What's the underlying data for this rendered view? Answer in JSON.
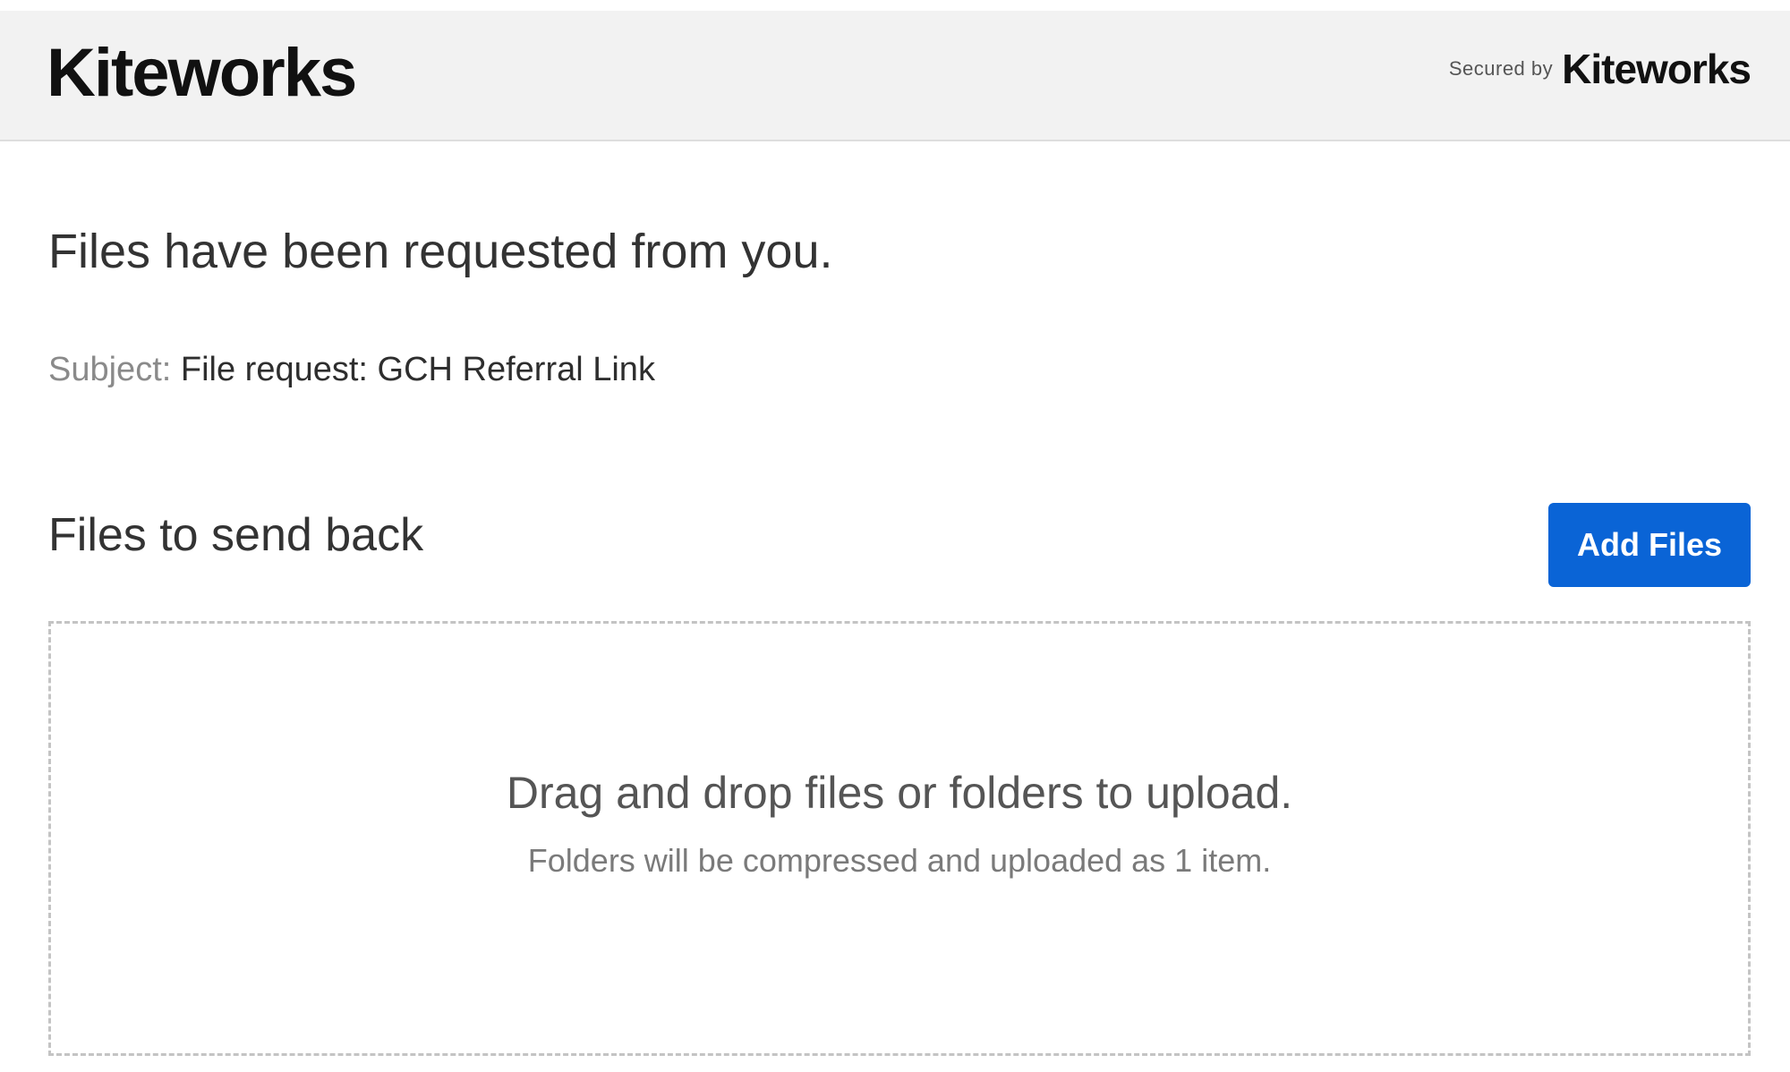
{
  "header": {
    "brand": "Kiteworks",
    "secured_by_text": "Secured by",
    "secured_by_brand": "Kiteworks"
  },
  "request": {
    "title": "Files have been requested from you.",
    "subject_label": "Subject:",
    "subject_value": "File request: GCH Referral Link"
  },
  "files_section": {
    "title": "Files to send back",
    "add_files_label": "Add Files",
    "dropzone_primary": "Drag and drop files or folders to upload.",
    "dropzone_secondary": "Folders will be compressed and uploaded as 1 item."
  },
  "colors": {
    "accent": "#0a64d6",
    "header_bg": "#f2f2f2",
    "logo_dot": "#2a55e5"
  }
}
